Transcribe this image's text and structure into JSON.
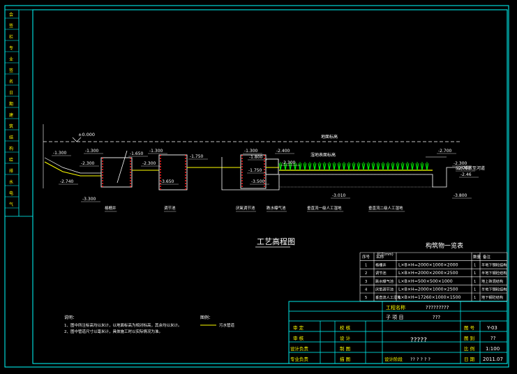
{
  "drawing": {
    "title": "工艺高程图",
    "ground_label": "地面标高",
    "ground_elev": "±0.000",
    "levels": {
      "l1": "-1.300",
      "l2": "-2.300",
      "l3": "-2.740",
      "l4": "-3.300",
      "l5": "-1.300",
      "l6": "-1.650",
      "l7": "-2.300",
      "l8": "-1.300",
      "l9": "-3.650",
      "l10": "-1.750",
      "l11": "-1.300",
      "l12": "-1.800",
      "l13": "-2.400",
      "l14": "-2.300",
      "l15": "-1.750",
      "l16": "-3.500",
      "l17": "-3.010",
      "l18": "-2.700",
      "l19": "-2.300",
      "l20": "-2.700",
      "l21": "-3.800",
      "l22": "-2.46"
    },
    "units": [
      "格栅井",
      "调节池",
      "厌氧调节池",
      "跌水曝气池",
      "垂直流一级人工湿地",
      "垂直流二级人工湿地"
    ],
    "wetland_surface": "湿地表面标高",
    "outlet": "出水排放至河道",
    "notes": {
      "title": "说明：",
      "lines": [
        "1、图中所注标高均以米计，以地面标高为相对标高，其余均以米计。",
        "2、图中管道尺寸以毫米计，具体施工时以实际情况为准。"
      ]
    },
    "legend": {
      "title": "图例：",
      "pipe": "污水管道"
    }
  },
  "structure_table": {
    "title": "构筑物一览表",
    "unit_note": "尺寸(mm)",
    "headers": [
      "序号",
      "名称",
      "",
      "数量",
      "备注"
    ],
    "rows": [
      [
        "1",
        "格栅井",
        "L×B×H=2000×1000×2000",
        "1",
        "半地下钢砼结构"
      ],
      [
        "2",
        "调节池",
        "L×B×H=2000×2000×2500",
        "1",
        "半地下钢砼结构"
      ],
      [
        "3",
        "跌水曝气池",
        "L×B×H=500×500×1000",
        "1",
        "地上砖混结构"
      ],
      [
        "4",
        "厌氧调节池",
        "L×B×H=2000×1000×2500",
        "1",
        "半地下钢砼结构"
      ],
      [
        "5",
        "垂直流人工湿地",
        "L×B×H=17260×1000×1500",
        "1",
        "地下钢砼结构"
      ]
    ]
  },
  "title_block": {
    "project_name_label": "工程名称",
    "project_name_value": "?????????",
    "sub_project_label": "子 项 目",
    "sub_project_value": "???",
    "roles_left": [
      "审 定",
      "审 核",
      "设计负责",
      "专业负责"
    ],
    "roles_mid": [
      "校 核",
      "设 计",
      "制 图",
      "描 图"
    ],
    "drawing_name": "?????",
    "design_stage_label": "设计阶段",
    "design_stage_value": "?? ? ? ? ?",
    "fields": [
      {
        "label": "图 号",
        "value": "Y-03"
      },
      {
        "label": "图 别",
        "value": "??"
      },
      {
        "label": "比 例",
        "value": "1:100"
      },
      {
        "label": "日 期",
        "value": "2011.07"
      }
    ]
  },
  "left_strip": [
    "会",
    "签",
    "栏",
    "专",
    "业",
    "签",
    "名",
    "日",
    "期",
    "建",
    "筑",
    "结",
    "构",
    "给",
    "排",
    "水",
    "电",
    "气"
  ],
  "colors": {
    "frame": "#00ffff",
    "ground_line": "#ffffff",
    "level_text": "#ffffff",
    "pipe": "#ffff00",
    "plant": "#00ff00",
    "structure": "#ffffff",
    "section_line": "#ff00ff",
    "red": "#ff2020"
  }
}
